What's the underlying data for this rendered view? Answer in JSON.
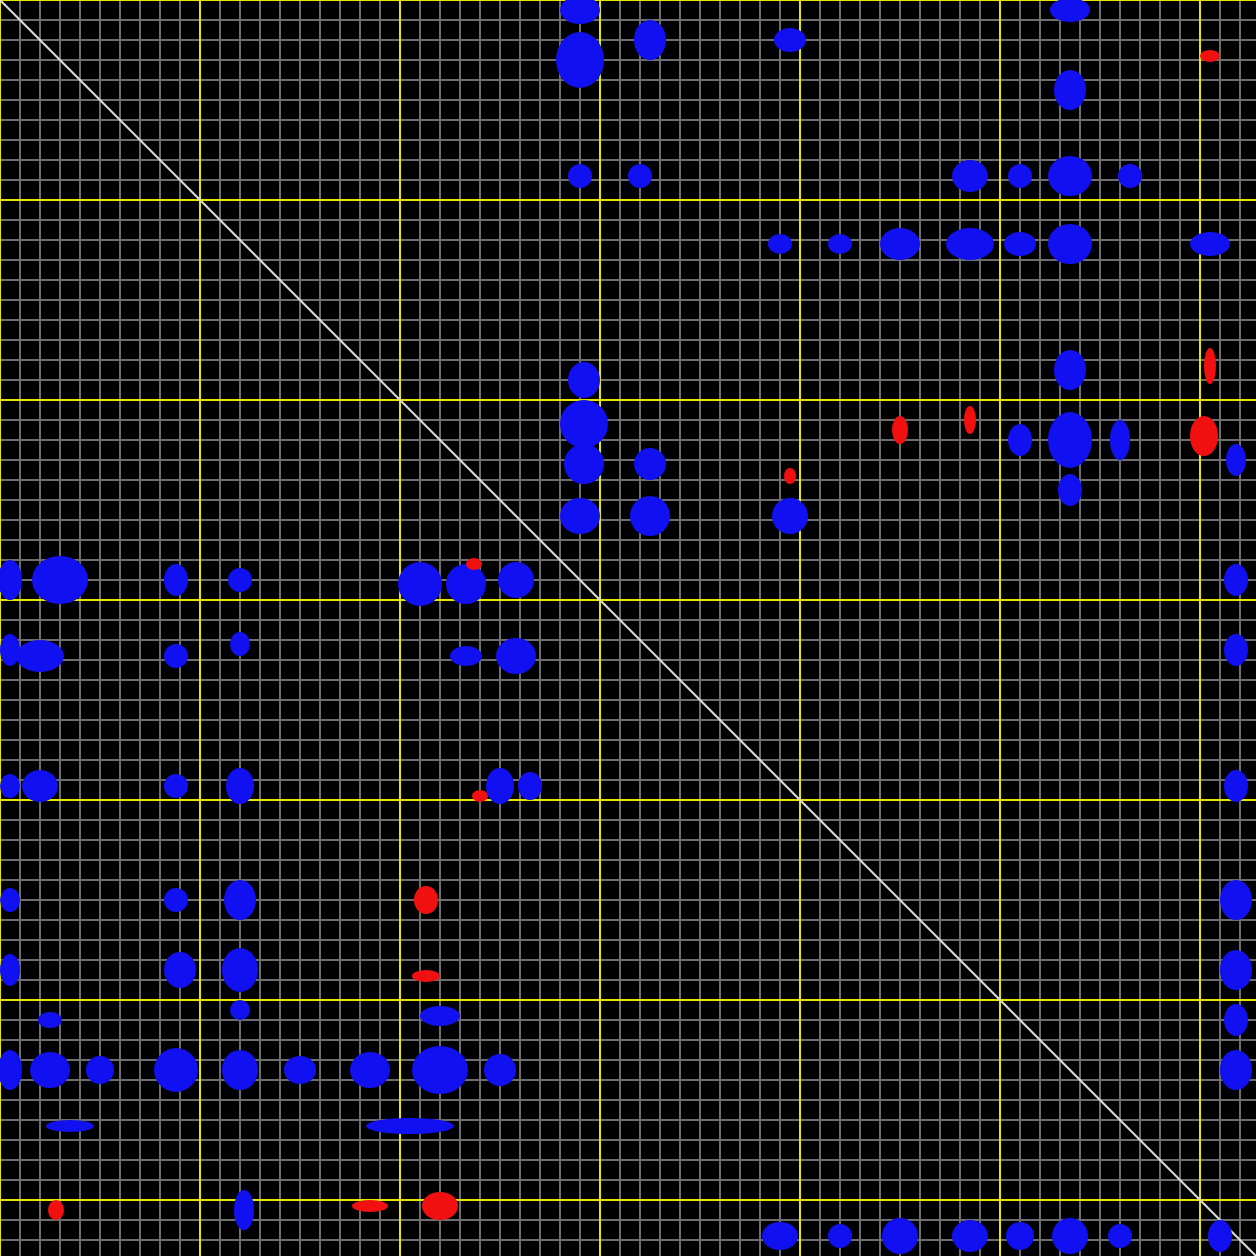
{
  "spectrum": {
    "kind": "contour"
  }
}
